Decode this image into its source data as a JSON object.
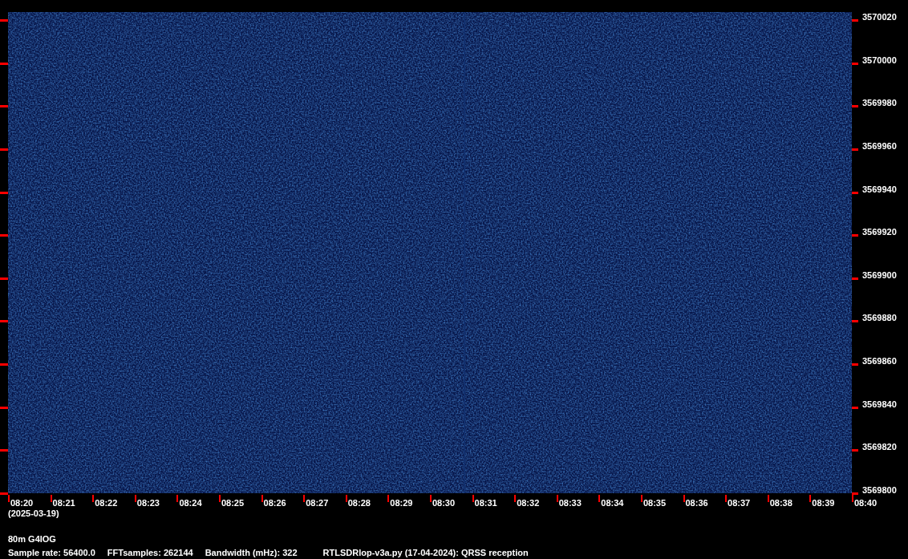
{
  "waterfall": {
    "frequency_labels": [
      "3570020",
      "3570000",
      "3569980",
      "3569960",
      "3569940",
      "3569920",
      "3569900",
      "3569880",
      "3569860",
      "3569840",
      "3569820",
      "3569800"
    ],
    "time_labels": [
      "08:20",
      "08:21",
      "08:22",
      "08:23",
      "08:24",
      "08:25",
      "08:26",
      "08:27",
      "08:28",
      "08:29",
      "08:30",
      "08:31",
      "08:32",
      "08:33",
      "08:34",
      "08:35",
      "08:36",
      "08:37",
      "08:38",
      "08:39",
      "08:40"
    ],
    "date": "(2025-03-19)"
  },
  "info": {
    "title": "80m G4IOG",
    "fields": [
      "Sample rate: 56400.0",
      "FFTsamples: 262144",
      "Bandwidth (mHz): 322",
      "RTLSDRlop-v3a.py (17-04-2024): QRSS reception"
    ]
  }
}
